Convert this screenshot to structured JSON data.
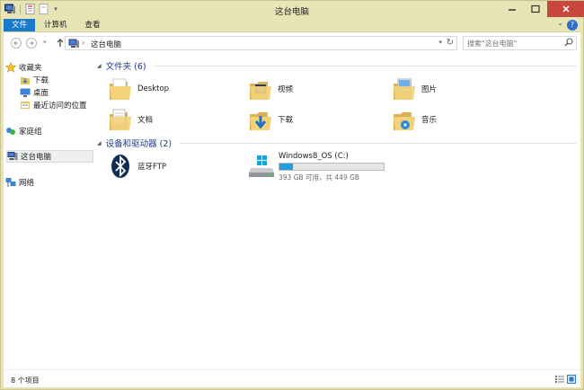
{
  "window": {
    "title": "这台电脑"
  },
  "ribbon": {
    "tabs": [
      {
        "label": "文件"
      },
      {
        "label": "计算机"
      },
      {
        "label": "查看"
      }
    ],
    "help_label": "?"
  },
  "address": {
    "crumb": "这台电脑",
    "search_placeholder": "搜索\"这台电脑\""
  },
  "nav": {
    "favorites": "收藏夹",
    "downloads": "下载",
    "desktop": "桌面",
    "recent": "最近访问的位置",
    "homegroup": "家庭组",
    "this_pc": "这台电脑",
    "network": "网络"
  },
  "folders_group": {
    "title": "文件夹 (6)"
  },
  "folders": [
    {
      "label": "Desktop",
      "icon": "desktop-folder-icon"
    },
    {
      "label": "视频",
      "icon": "videos-folder-icon"
    },
    {
      "label": "图片",
      "icon": "pictures-folder-icon"
    },
    {
      "label": "文档",
      "icon": "documents-folder-icon"
    },
    {
      "label": "下载",
      "icon": "downloads-folder-icon"
    },
    {
      "label": "音乐",
      "icon": "music-folder-icon"
    }
  ],
  "devices_group": {
    "title": "设备和驱动器 (2)"
  },
  "devices": {
    "bluetooth_ftp": "蓝牙FTP",
    "drive": {
      "name": "Windows8_OS (C:)",
      "free_text": "393 GB 可用，共 449 GB",
      "used_fraction": 0.125
    }
  },
  "status": {
    "item_count": "8 个项目"
  },
  "colors": {
    "accent": "#1979ca",
    "title_bar": "#e7e4b6",
    "close": "#c7473d",
    "drive_bar": "#26a0da"
  }
}
